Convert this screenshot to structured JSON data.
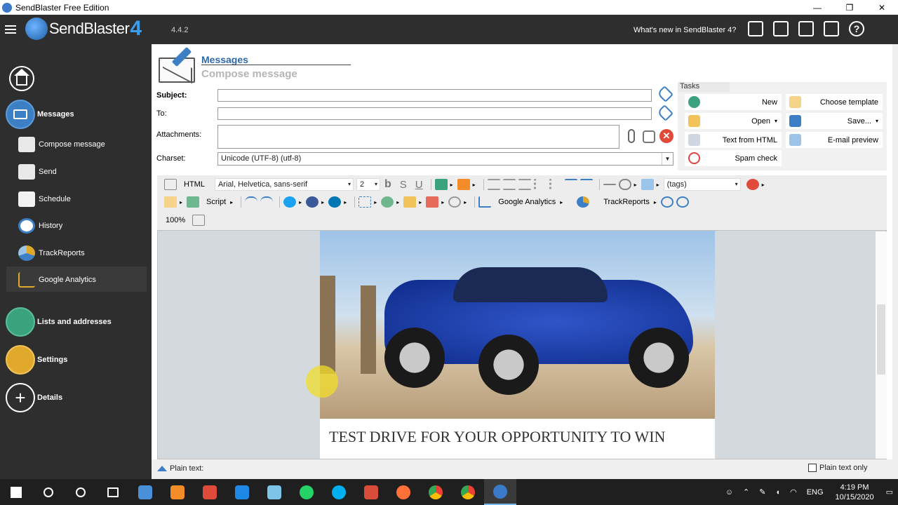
{
  "window": {
    "title": "SendBlaster Free Edition",
    "minimize": "—",
    "restore": "❐",
    "close": "✕"
  },
  "topbar": {
    "brand": "SendBlaster",
    "brand_suffix": "4",
    "version": "4.4.2",
    "whats_new": "What's new in SendBlaster 4?",
    "icons": [
      "cart-icon",
      "calendar-icon",
      "contacts-icon",
      "film-icon",
      "help-icon"
    ],
    "help_glyph": "?"
  },
  "sidebar": {
    "messages": "Messages",
    "message_items": [
      "Compose message",
      "Send",
      "Schedule",
      "History",
      "TrackReports",
      "Google Analytics"
    ],
    "lists": "Lists and addresses",
    "settings": "Settings",
    "details": "Details",
    "details_glyph": "+"
  },
  "header": {
    "section": "Messages",
    "subtitle": "Compose message"
  },
  "form": {
    "subject_label": "Subject:",
    "subject_value": "",
    "to_label": "To:",
    "to_value": "",
    "attachments_label": "Attachments:",
    "charset_label": "Charset:",
    "charset_value": "Unicode (UTF-8)    (utf-8)",
    "remove_glyph": "✕"
  },
  "tasks": {
    "title": "Tasks",
    "new": "New",
    "choose_template": "Choose template",
    "open": "Open",
    "save": "Save...",
    "text_from_html": "Text from HTML",
    "email_preview": "E-mail preview",
    "spam_check": "Spam check",
    "dropdown_glyph": "▾"
  },
  "toolbar": {
    "html": "HTML",
    "font": "Arial, Helvetica, sans-serif",
    "size": "2",
    "bold": "b",
    "italic": "S",
    "underline": "U",
    "tags": "(tags)",
    "script": "Script",
    "google_analytics": "Google Analytics",
    "trackreports": "TrackReports",
    "zoom": "100%",
    "dropdown_glyph": "▾",
    "menu_glyph": "▸"
  },
  "editor": {
    "heading": "TEST DRIVE FOR YOUR OPPORTUNITY TO WIN"
  },
  "statusbar": {
    "plain_text": "Plain text:",
    "plain_text_only": "Plain text only"
  },
  "taskbar": {
    "lang": "ENG",
    "time": "4:19 PM",
    "date": "10/15/2020"
  },
  "colors": {
    "dark_panel": "#2e2e2e",
    "accent_blue": "#3d7fc4",
    "heading_blue": "#2f6aa8"
  }
}
